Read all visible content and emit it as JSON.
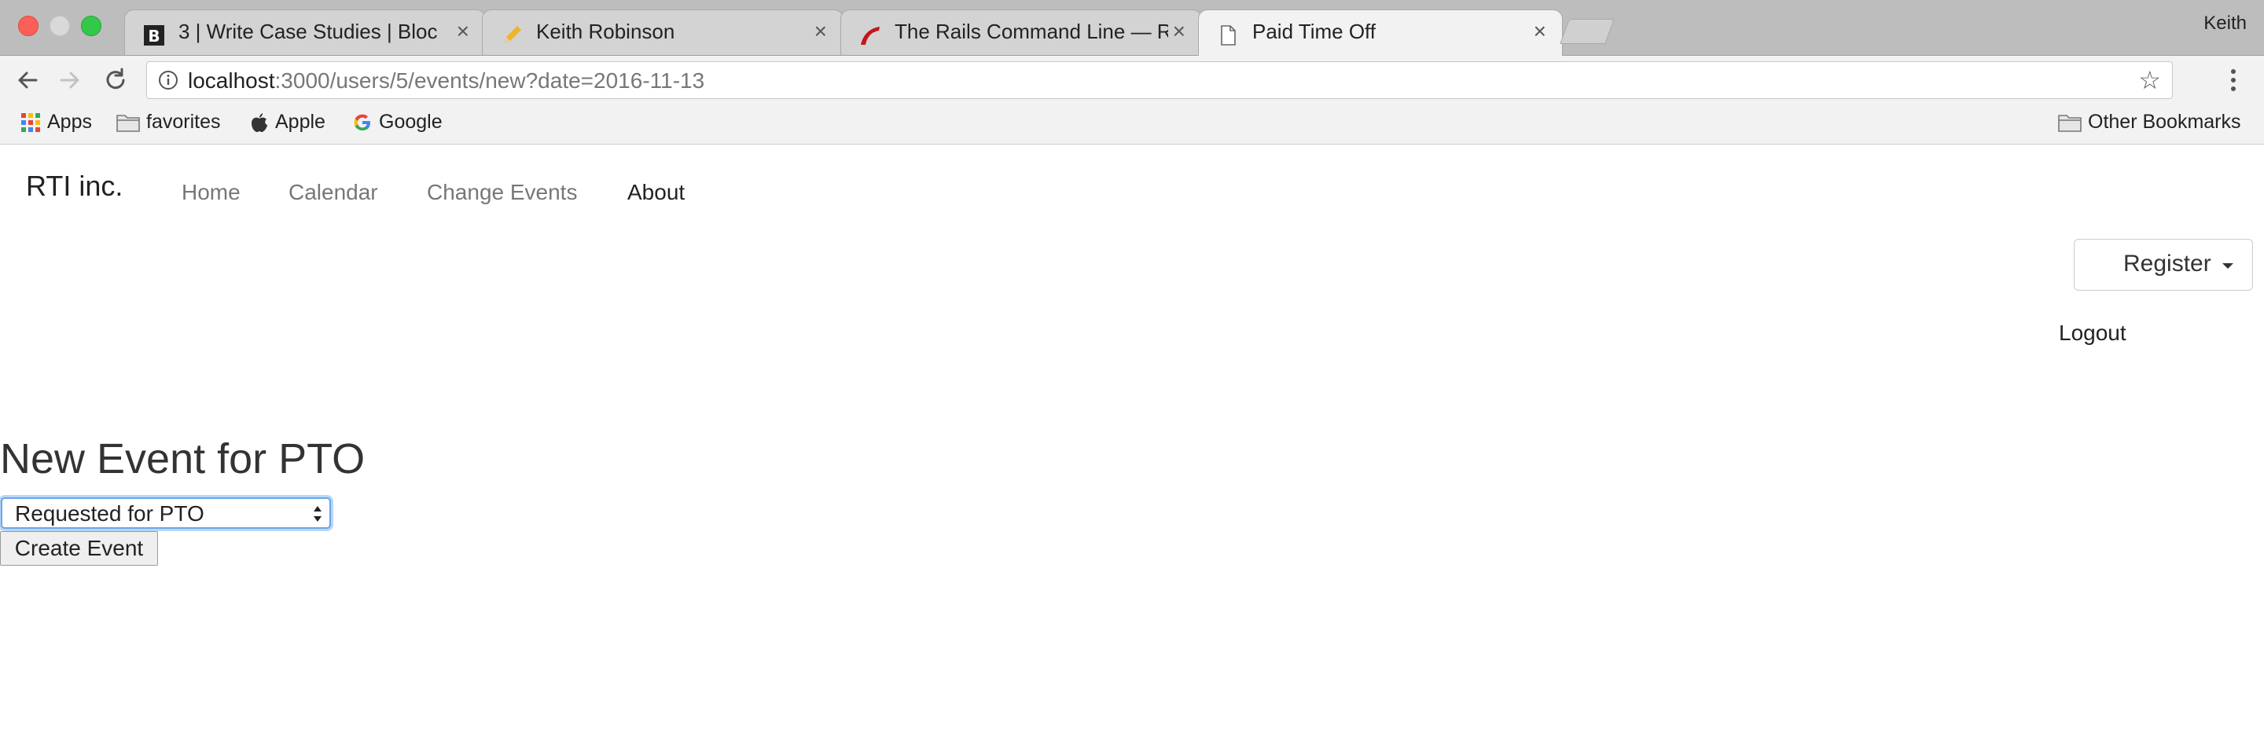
{
  "browser": {
    "tabs": [
      {
        "title": "3 | Write Case Studies | Bloc",
        "active": false
      },
      {
        "title": "Keith Robinson",
        "active": false
      },
      {
        "title": "The Rails Command Line — Ru",
        "active": false
      },
      {
        "title": "Paid Time Off",
        "active": true
      }
    ],
    "close_glyph": "×",
    "profile_name": "Keith",
    "url_host": "localhost",
    "url_rest": ":3000/users/5/events/new?date=2016-11-13",
    "star_glyph": "☆",
    "bookmarks": [
      {
        "label": "Apps",
        "icon": "apps-grid-icon"
      },
      {
        "label": "favorites",
        "icon": "folder-icon"
      },
      {
        "label": "Apple",
        "icon": "apple-icon"
      },
      {
        "label": "Google",
        "icon": "google-icon"
      }
    ],
    "other_bookmarks": "Other Bookmarks"
  },
  "site": {
    "brand": "RTI inc.",
    "nav": [
      "Home",
      "Calendar",
      "Change Events",
      "About"
    ],
    "register_label": "Register",
    "logout_label": "Logout"
  },
  "form": {
    "heading": "New Event for PTO",
    "select_value": "Requested for PTO",
    "submit_label": "Create Event"
  },
  "colors": {
    "focus_ring": "#6aa6e8",
    "tabstrip": "#bdbdbd",
    "active_tab": "#f2f2f2"
  }
}
